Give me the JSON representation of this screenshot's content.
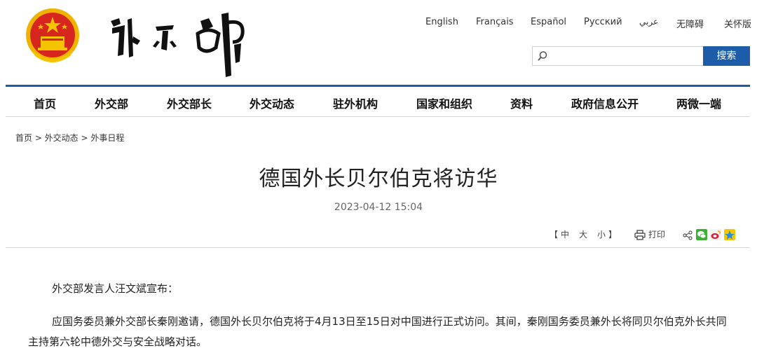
{
  "header": {
    "languages": [
      "English",
      "Français",
      "Español",
      "Русский",
      "عربي",
      "无障碍",
      "关怀版"
    ],
    "search": {
      "placeholder": "",
      "button_label": "搜索"
    }
  },
  "nav": {
    "items": [
      "首页",
      "外交部",
      "外交部长",
      "外交动态",
      "驻外机构",
      "国家和组织",
      "资料",
      "政府信息公开",
      "两微一端"
    ]
  },
  "breadcrumb": "首页 > 外交动态 > 外事日程",
  "article": {
    "title": "德国外长贝尔伯克将访华",
    "date": "2023-04-12 15:04",
    "font_size_controls": {
      "open": "【",
      "large": "中",
      "medium": "大",
      "small": "小",
      "close": "】"
    },
    "print_label": "打印",
    "paragraphs": [
      "外交部发言人汪文斌宣布：",
      "应国务委员兼外交部长秦刚邀请，德国外长贝尔伯克将于4月13日至15日对中国进行正式访问。其间，秦刚国务委员兼外长将同贝尔伯克外长共同主持第六轮中德外交与安全战略对话。"
    ]
  },
  "colors": {
    "accent_blue": "#1c5ca8",
    "emblem_red": "#d7261e",
    "emblem_gold": "#f5c400"
  }
}
